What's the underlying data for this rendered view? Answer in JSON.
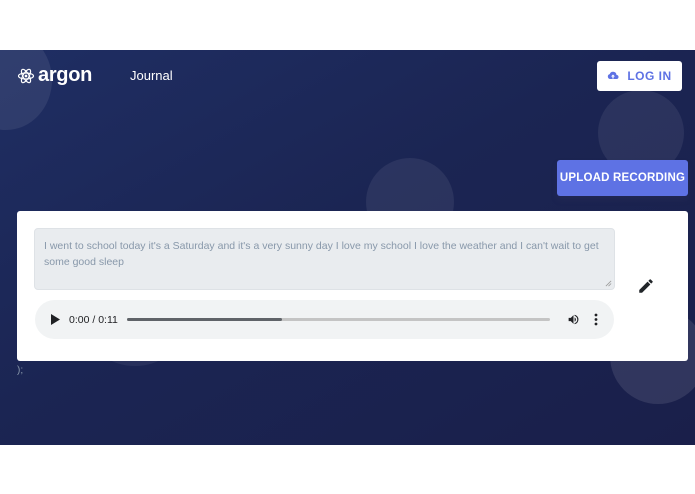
{
  "nav": {
    "logo_text": "argon",
    "links": [
      "Journal"
    ],
    "login_label": "LOG IN"
  },
  "upload_button_label": "UPLOAD RECORDING",
  "entry": {
    "text": "I went to school today it's a Saturday and it's a very sunny day I love my school I love the weather and I can't wait to get some good sleep",
    "audio": {
      "time_display": "0:00 / 0:11",
      "progress_fraction": 0.366
    }
  },
  "stray_text": ");",
  "colors": {
    "primary": "#5e72e4",
    "hero_background": "#1b2553",
    "card_background": "#ffffff",
    "textarea_background": "#e9ecef"
  },
  "icons": {
    "logo": "atom-icon",
    "login": "cloud-upload-icon",
    "edit": "pencil-icon",
    "play": "play-icon",
    "volume": "volume-icon",
    "more": "more-vertical-icon"
  }
}
